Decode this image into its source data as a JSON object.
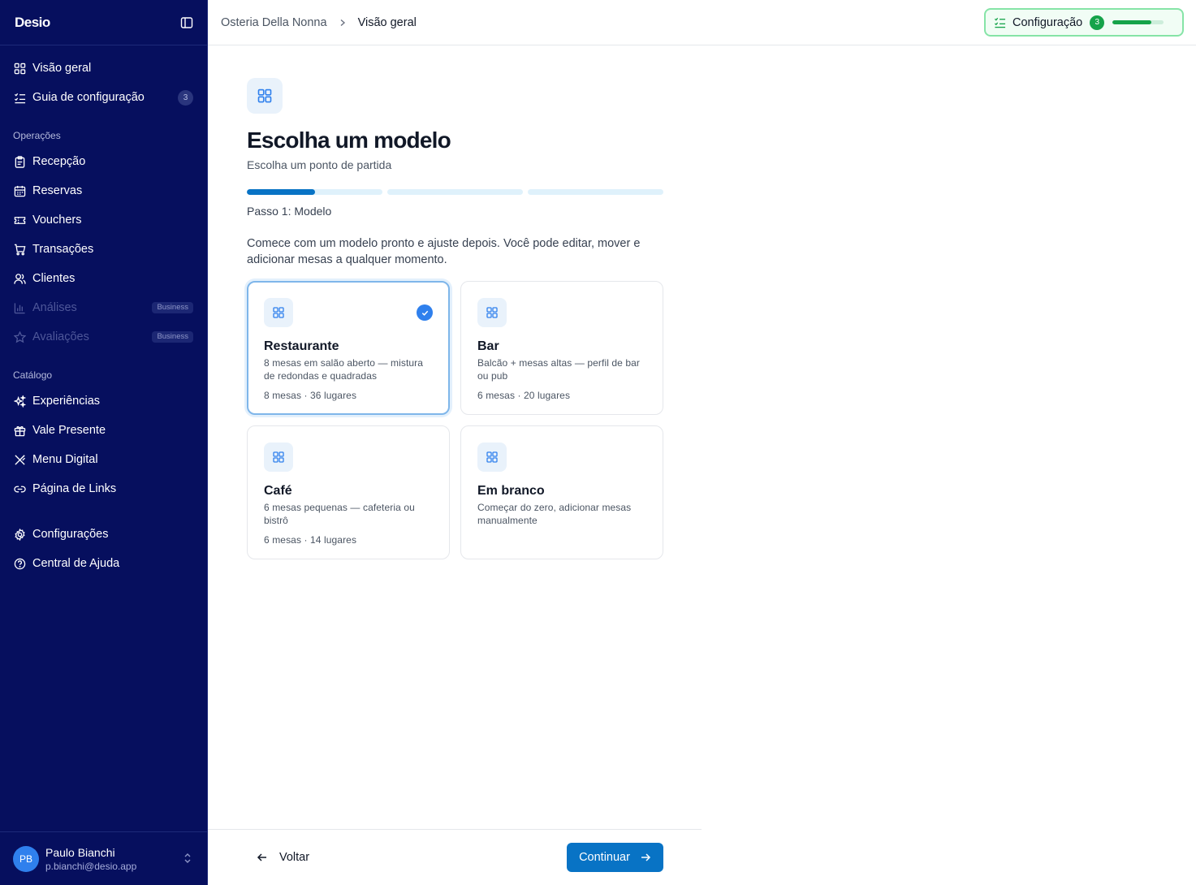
{
  "app": {
    "logo": "Desio"
  },
  "sidebar": {
    "top_items": [
      {
        "label": "Visão geral",
        "icon": "grid-icon"
      },
      {
        "label": "Guia de configuração",
        "icon": "checklist-icon",
        "count": "3"
      }
    ],
    "sections": [
      {
        "label": "Operações",
        "items": [
          {
            "label": "Recepção",
            "icon": "clipboard-icon"
          },
          {
            "label": "Reservas",
            "icon": "calendar-icon"
          },
          {
            "label": "Vouchers",
            "icon": "ticket-icon"
          },
          {
            "label": "Transações",
            "icon": "cart-icon"
          },
          {
            "label": "Clientes",
            "icon": "users-icon"
          },
          {
            "label": "Análises",
            "icon": "bar-chart-icon",
            "tier": "Business",
            "disabled": true
          },
          {
            "label": "Avaliações",
            "icon": "star-icon",
            "tier": "Business",
            "disabled": true
          }
        ]
      },
      {
        "label": "Catálogo",
        "items": [
          {
            "label": "Experiências",
            "icon": "sparkles-icon"
          },
          {
            "label": "Vale Presente",
            "icon": "gift-icon"
          },
          {
            "label": "Menu Digital",
            "icon": "utensils-icon"
          },
          {
            "label": "Página de Links",
            "icon": "link-icon"
          }
        ]
      }
    ],
    "bottom_items": [
      {
        "label": "Configurações",
        "icon": "gear-icon"
      },
      {
        "label": "Central de Ajuda",
        "icon": "help-circle-icon"
      }
    ],
    "user": {
      "initials": "PB",
      "name": "Paulo Bianchi",
      "email": "p.bianchi@desio.app"
    }
  },
  "topbar": {
    "breadcrumb": [
      "Osteria Della Nonna",
      "Visão geral"
    ],
    "setup": {
      "label": "Configuração",
      "count": "3",
      "progress": 0.75
    }
  },
  "main": {
    "title": "Escolha um modelo",
    "subtitle": "Escolha um ponto de partida",
    "steps": {
      "total": 3,
      "current": 1,
      "current_fill": 0.5,
      "label": "Passo 1: Modelo"
    },
    "intro": "Comece com um modelo pronto e ajuste depois. Você pode editar, mover e adicionar mesas a qualquer momento.",
    "templates": [
      {
        "title": "Restaurante",
        "desc": "8 mesas em salão aberto — mistura de redondas e quadradas",
        "meta": "8 mesas · 36 lugares",
        "selected": true
      },
      {
        "title": "Bar",
        "desc": "Balcão + mesas altas — perfil de bar ou pub",
        "meta": "6 mesas · 20 lugares",
        "selected": false
      },
      {
        "title": "Café",
        "desc": "6 mesas pequenas — cafeteria ou bistrô",
        "meta": "6 mesas · 14 lugares",
        "selected": false
      },
      {
        "title": "Em branco",
        "desc": "Começar do zero, adicionar mesas manualmente",
        "meta": "",
        "selected": false
      }
    ]
  },
  "footer": {
    "back_label": "Voltar",
    "continue_label": "Continuar"
  },
  "colors": {
    "sidebar_bg": "#060f5e",
    "primary": "#0873c5",
    "success": "#16a34a",
    "selected_border": "#7fb6ea"
  }
}
